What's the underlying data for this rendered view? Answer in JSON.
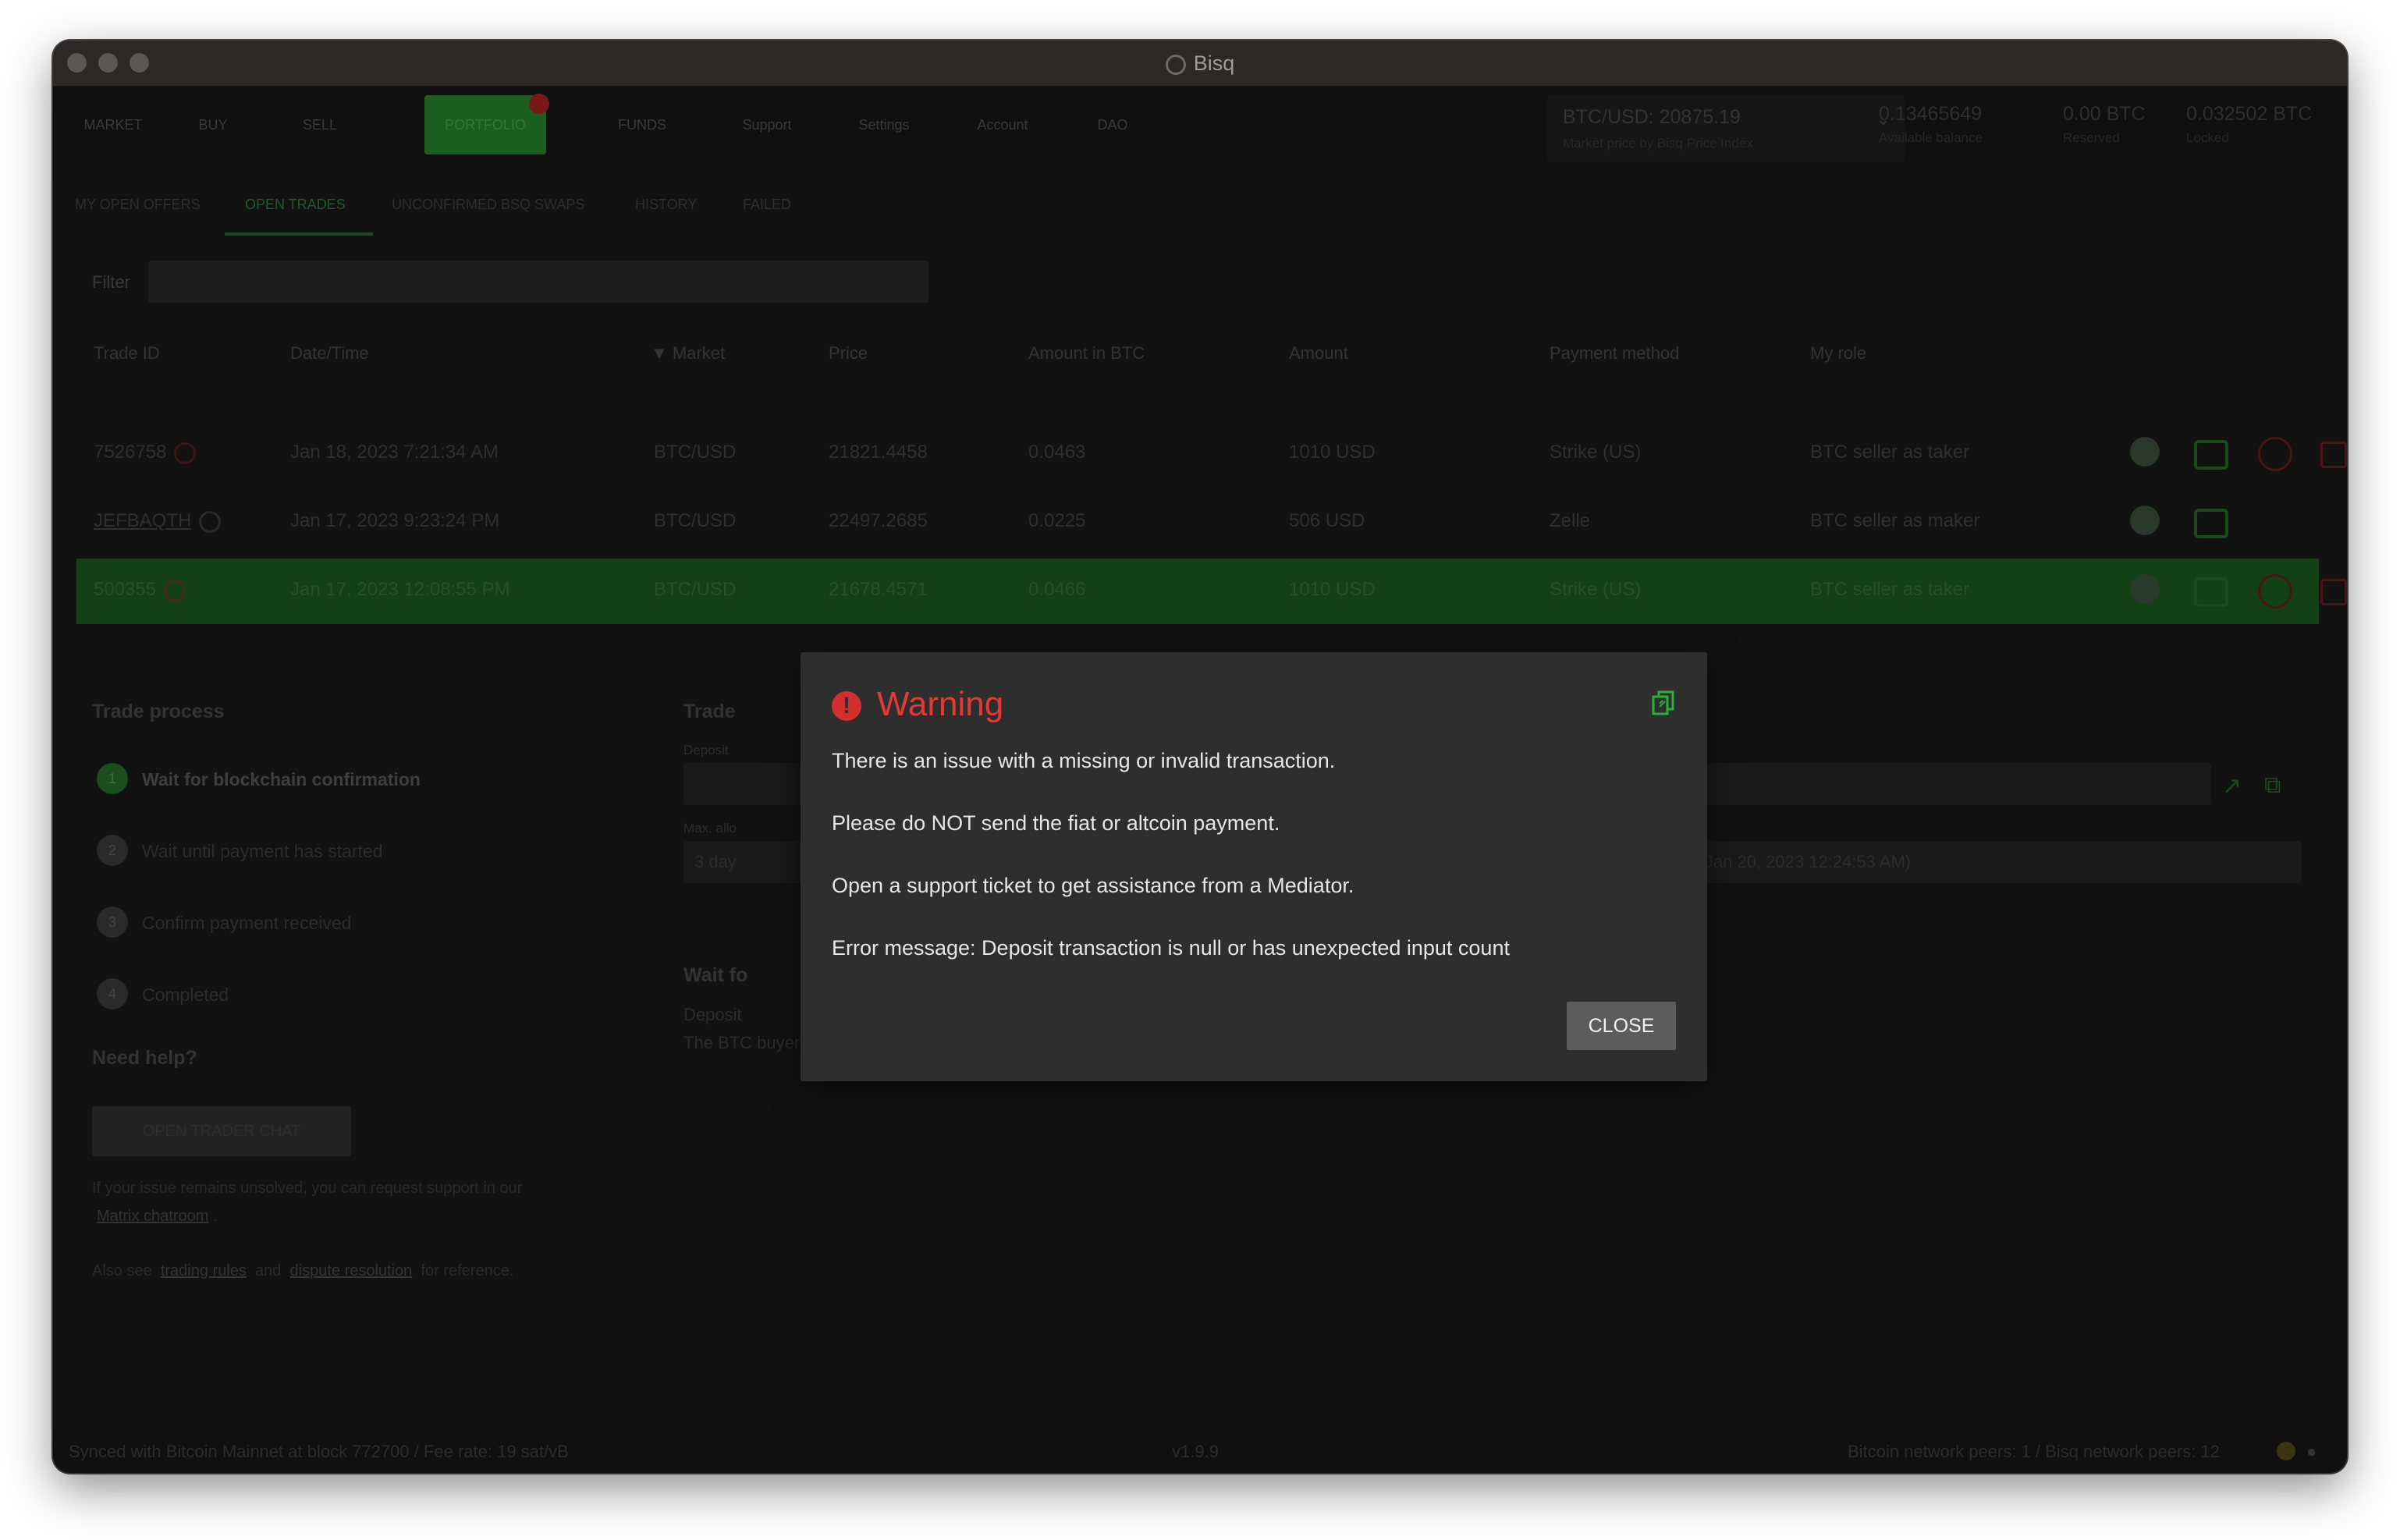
{
  "window": {
    "title": "Bisq"
  },
  "nav": {
    "tabs": [
      "MARKET",
      "BUY",
      "SELL",
      "PORTFOLIO",
      "FUNDS",
      "Support",
      "Settings",
      "Account",
      "DAO"
    ],
    "active": "PORTFOLIO"
  },
  "balances": {
    "price": {
      "value": "BTC/USD: 20875.19",
      "label": "Market price by Bisq Price Index"
    },
    "available": {
      "value": "0.13465649",
      "label": "Available balance"
    },
    "reserved": {
      "value": "0.00 BTC",
      "label": "Reserved"
    },
    "locked": {
      "value": "0.032502 BTC",
      "label": "Locked"
    }
  },
  "subtabs": [
    "MY OPEN OFFERS",
    "OPEN TRADES",
    "UNCONFIRMED BSQ SWAPS",
    "HISTORY",
    "FAILED"
  ],
  "filter": {
    "label": "Filter"
  },
  "table": {
    "headers": [
      "Trade ID",
      "Date/Time",
      "▼ Market",
      "Price",
      "Amount in BTC",
      "Amount",
      "Payment method",
      "My role"
    ],
    "rows": [
      {
        "id": "7526758",
        "date": "Jan 18, 2023 7:21:34 AM",
        "market": "BTC/USD",
        "price": "21821.4458",
        "amount_btc": "0.0463",
        "amount": "1010 USD",
        "method": "Strike (US)",
        "role": "BTC seller as taker"
      },
      {
        "id": "JEFBAQTH",
        "date": "Jan 17, 2023 9:23:24 PM",
        "market": "BTC/USD",
        "price": "22497.2685",
        "amount_btc": "0.0225",
        "amount": "506 USD",
        "method": "Zelle",
        "role": "BTC seller as maker"
      },
      {
        "id": "500355",
        "date": "Jan 17, 2023 12:08:55 PM",
        "market": "BTC/USD",
        "price": "21678.4571",
        "amount_btc": "0.0466",
        "amount": "1010 USD",
        "method": "Strike (US)",
        "role": "BTC seller as taker"
      }
    ]
  },
  "trade_process": {
    "title": "Trade process",
    "steps": [
      {
        "num": "1",
        "label": "Wait for blockchain confirmation"
      },
      {
        "num": "2",
        "label": "Wait until payment has started"
      },
      {
        "num": "3",
        "label": "Confirm payment received"
      },
      {
        "num": "4",
        "label": "Completed"
      }
    ],
    "help_title": "Need help?",
    "chat_button": "OPEN TRADER CHAT",
    "help_text_1": "If your issue remains unsolved, you can request support in our",
    "help_link_1": "Matrix chatroom",
    "also_see": "Also see",
    "link_rules": "trading rules",
    "and": "and",
    "link_dispute": "dispute resolution",
    "for_reference": "for reference."
  },
  "right_panel": {
    "title": "Trade",
    "deposit_label": "Deposit",
    "max_label": "Max. allo",
    "max_value": "3 day",
    "max_suffix": "s (until Jan 20, 2023 12:24:53 AM)",
    "wait_title": "Wait fo",
    "wait_line1": "Deposit",
    "wait_line2": "The BTC buyer must wait for at least one blockchain confirmation before starting the payment."
  },
  "status": {
    "sync": "Synced with Bitcoin Mainnet at block 772700 / Fee rate: 19 sat/vB",
    "version": "v1.9.9",
    "peers": "Bitcoin network peers: 1 / Bisq network peers: 12"
  },
  "dialog": {
    "title": "Warning",
    "line1": "There is an issue with a missing or invalid transaction.",
    "line2": "Please do NOT send the fiat or altcoin payment.",
    "line3": "Open a support ticket to get assistance from a Mediator.",
    "line4": "Error message: Deposit transaction is null or has unexpected input count",
    "close": "CLOSE"
  },
  "colors": {
    "warning": "#e53935",
    "accent": "#25b135",
    "dialog_bg": "#2e2e2e"
  }
}
